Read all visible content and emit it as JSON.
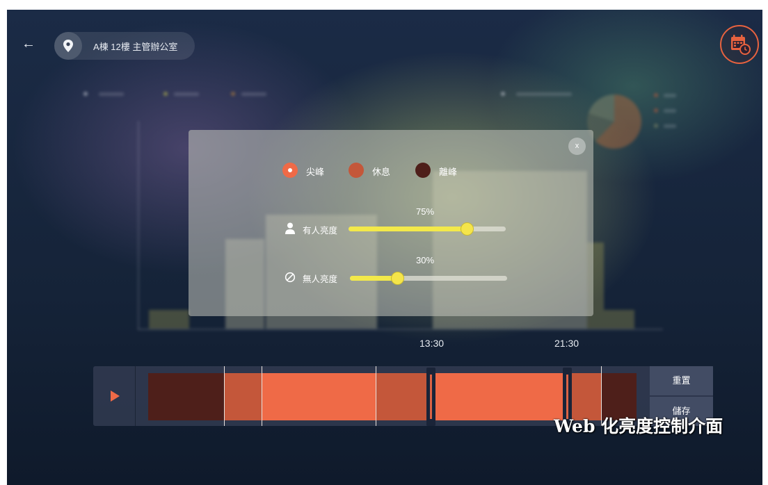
{
  "header": {
    "back_icon": "arrow-left-icon",
    "location_icon": "map-pin-icon",
    "location": "A棟 12樓 主管辦公室",
    "schedule_icon": "calendar-clock-icon"
  },
  "colors": {
    "accent": "#e8623f",
    "peak": "#ef6a47",
    "rest": "#c4573a",
    "off_peak": "#4e1f1a",
    "slider_fill": "#f3e94a"
  },
  "modal": {
    "close_label": "x",
    "legend": [
      {
        "label": "尖峰",
        "selected": true
      },
      {
        "label": "休息",
        "selected": false
      },
      {
        "label": "離峰",
        "selected": false
      }
    ],
    "occupied": {
      "icon": "person-icon",
      "label": "有人亮度",
      "value_text": "75%",
      "value": 0.75
    },
    "vacant": {
      "icon": "prohibited-icon",
      "label": "無人亮度",
      "value_text": "30%",
      "value": 0.3
    }
  },
  "timeline": {
    "play_icon": "play-icon",
    "markers": [
      "13:30",
      "21:30"
    ],
    "reset_label": "重置",
    "save_label": "儲存",
    "segments": [
      "off",
      "rest",
      "peak",
      "peak",
      "rest",
      "peak",
      "rest",
      "off"
    ]
  },
  "caption": "Web 化亮度控制介面"
}
